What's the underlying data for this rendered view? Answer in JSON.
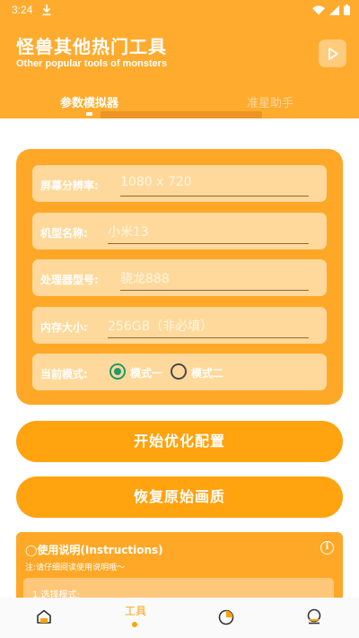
{
  "status_bar": {
    "time": "3:24"
  },
  "header": {
    "title": "怪兽其他热门工具",
    "subtitle": "Other popular tools of monsters"
  },
  "tabs": [
    {
      "label": "参数模拟器",
      "active": true
    },
    {
      "label": "准星助手",
      "active": false
    }
  ],
  "form": {
    "resolution": {
      "label": "屏幕分辨率:",
      "placeholder": "1080 x 720"
    },
    "model": {
      "label": "机型名称:",
      "placeholder": "小米13"
    },
    "processor": {
      "label": "处理器型号:",
      "placeholder": "骁龙888"
    },
    "memory": {
      "label": "内存大小:",
      "placeholder": "256GB（非必填）"
    },
    "mode": {
      "label": "当前模式:",
      "option1": "模式一",
      "option2": "模式二",
      "selected": "模式一"
    }
  },
  "buttons": {
    "start": "开始优化配置",
    "restore": "恢复原始画质"
  },
  "instructions": {
    "title": "◯使用说明(Instructions)",
    "note": "注:请仔细阅读使用说明哦～",
    "step1": "1.选择模式:"
  },
  "bottom_nav": {
    "active_label": "工具"
  },
  "colors": {
    "accent": "#ffab2e",
    "card": "#ffa827",
    "field": "#ffd99b",
    "radio_checked": "#1f9a6a"
  }
}
